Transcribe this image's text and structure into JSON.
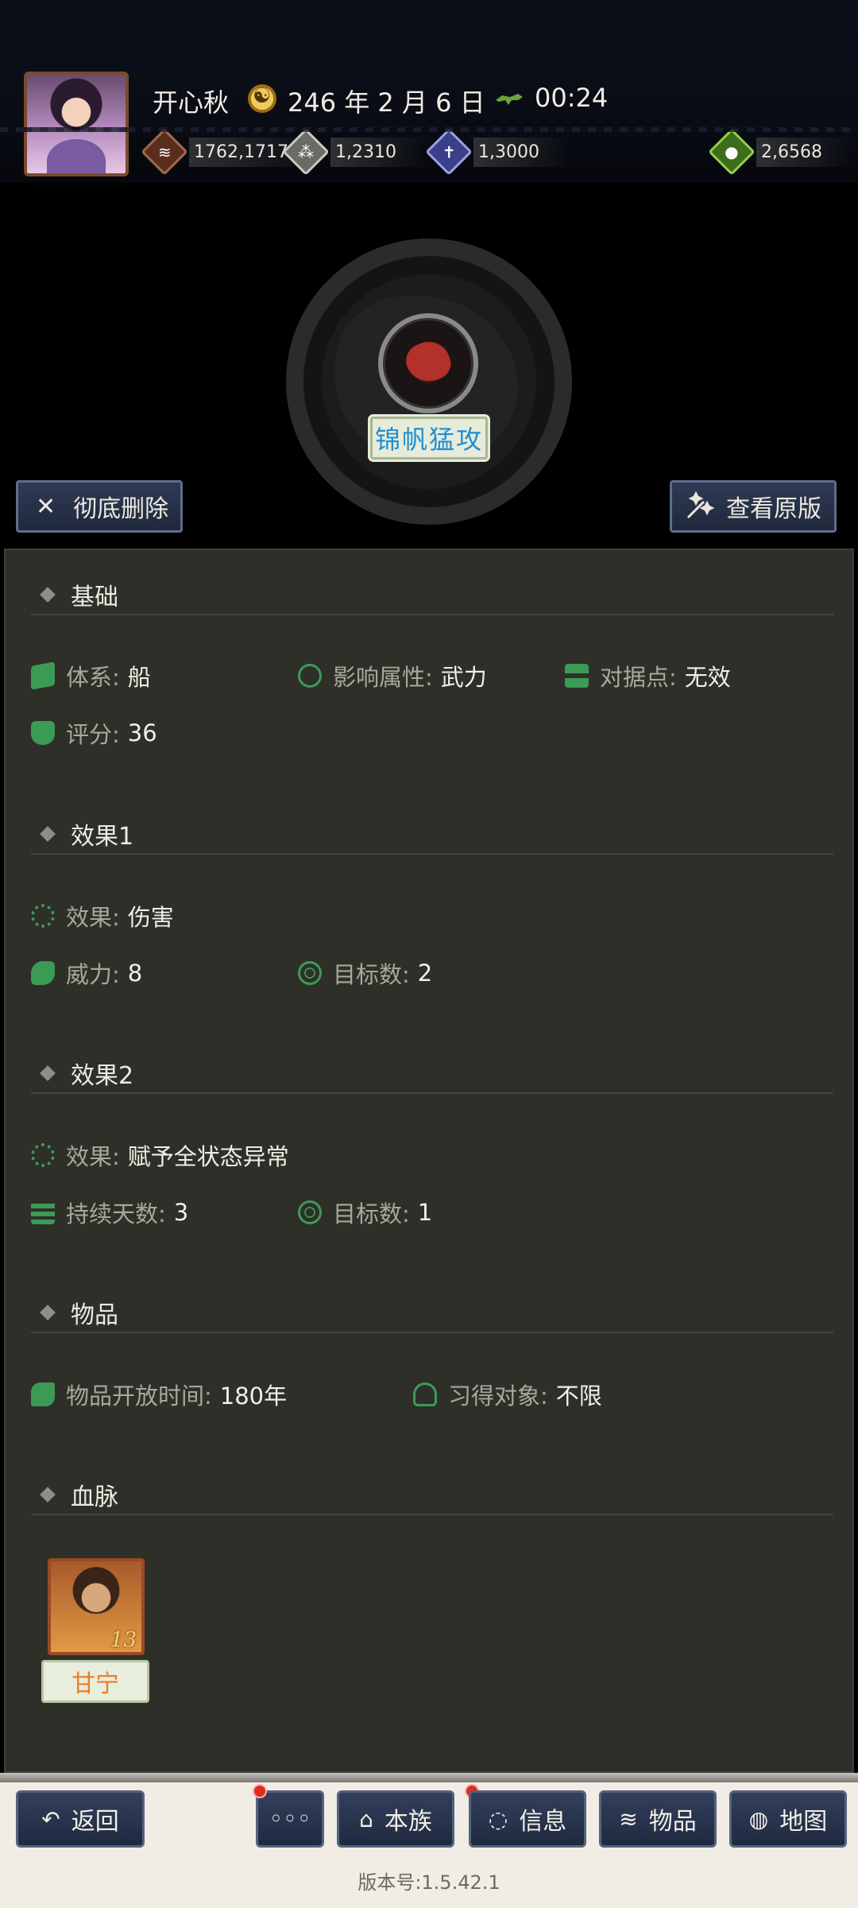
{
  "header": {
    "player_name": "开心秋",
    "date": "246 年 2 月 6 日",
    "time": "00:24",
    "resources": {
      "copper": "1762,1717",
      "grain": "1,2310",
      "soldiers": "1,3000",
      "gold": "2,6568"
    }
  },
  "skill": {
    "name": "锦帆猛攻"
  },
  "actions": {
    "delete_label": "彻底删除",
    "view_original_label": "查看原版"
  },
  "sections": {
    "basic": {
      "title": "基础",
      "system_label": "体系:",
      "system_value": "船",
      "attr_label": "影响属性:",
      "attr_value": "武力",
      "stronghold_label": "对据点:",
      "stronghold_value": "无效",
      "score_label": "评分:",
      "score_value": "36"
    },
    "effect1": {
      "title": "效果1",
      "effect_label": "效果:",
      "effect_value": "伤害",
      "power_label": "威力:",
      "power_value": "8",
      "targets_label": "目标数:",
      "targets_value": "2"
    },
    "effect2": {
      "title": "效果2",
      "effect_label": "效果:",
      "effect_value": "赋予全状态异常",
      "duration_label": "持续天数:",
      "duration_value": "3",
      "targets_label": "目标数:",
      "targets_value": "1"
    },
    "item": {
      "title": "物品",
      "open_time_label": "物品开放时间:",
      "open_time_value": "180年",
      "learner_label": "习得对象:",
      "learner_value": "不限"
    },
    "bloodline": {
      "title": "血脉",
      "general_name": "甘宁",
      "general_level": "13"
    }
  },
  "nav": {
    "back": "返回",
    "more": "◦◦◦",
    "clan": "本族",
    "info": "信息",
    "items": "物品",
    "map": "地图"
  },
  "version": "版本号:1.5.42.1"
}
